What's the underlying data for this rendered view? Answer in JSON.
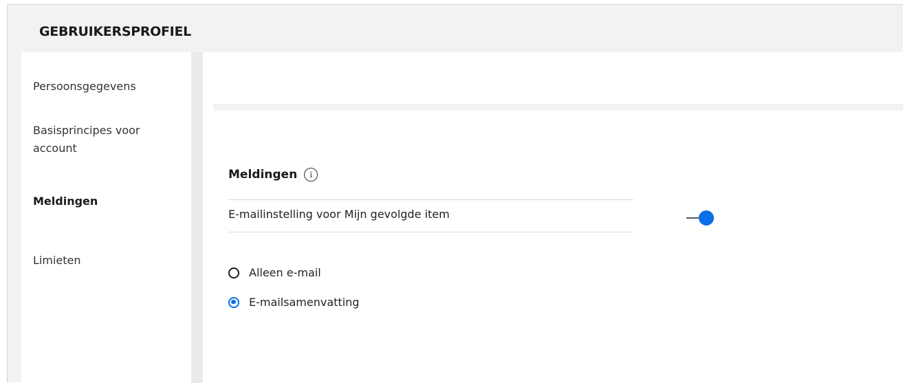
{
  "header": {
    "title": "GEBRUIKERSPROFIEL"
  },
  "sidebar": {
    "items": [
      {
        "label": "Persoonsgegevens",
        "active": false
      },
      {
        "label": "Basisprincipes voor account",
        "active": false
      },
      {
        "label": "Meldingen",
        "active": true
      },
      {
        "label": "Limieten",
        "active": false
      }
    ]
  },
  "notifications": {
    "title": "Meldingen",
    "info_icon": "info-icon",
    "setting_label": "E-mailinstelling voor Mijn gevolgde item",
    "toggle_on": true,
    "options": [
      {
        "label": "Alleen e-mail",
        "selected": false
      },
      {
        "label": "E-mailsamenvatting",
        "selected": true
      }
    ]
  },
  "colors": {
    "accent": "#0a6ee6",
    "background": "#f2f2f2",
    "panel": "#ffffff"
  }
}
